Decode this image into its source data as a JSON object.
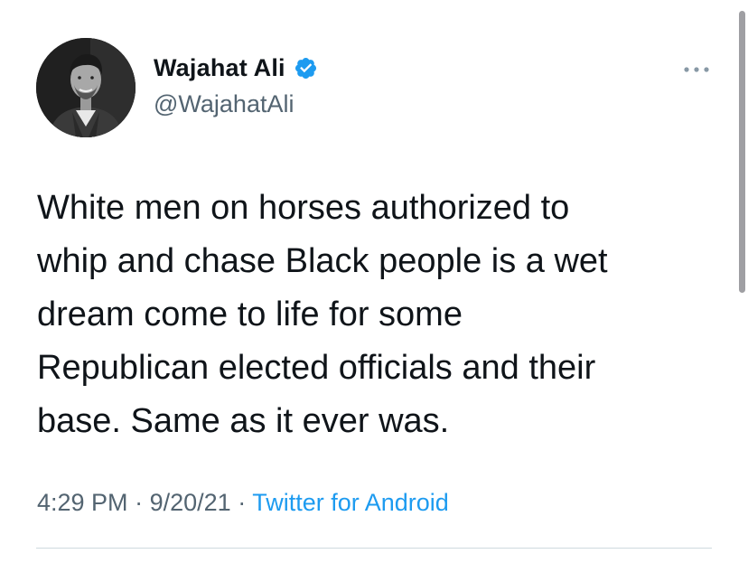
{
  "author": {
    "display_name": "Wajahat Ali",
    "handle": "@WajahatAli",
    "verified": true,
    "avatar_icon": "profile-photo"
  },
  "tweet": {
    "text": "White men on horses authorized to\nwhip and chase Black people is a wet\ndream come to life for some\nRepublican elected officials and their\nbase. Same as it ever was.",
    "time": "4:29 PM",
    "separator": "·",
    "date": "9/20/21",
    "source": "Twitter for Android"
  },
  "icons": {
    "verified": "verified-badge-icon",
    "more": "more-options-icon"
  },
  "colors": {
    "text_primary": "#0f1419",
    "text_secondary": "#536471",
    "link": "#1d9bf0",
    "verified": "#1d9bf0",
    "divider": "#cfd9de"
  }
}
